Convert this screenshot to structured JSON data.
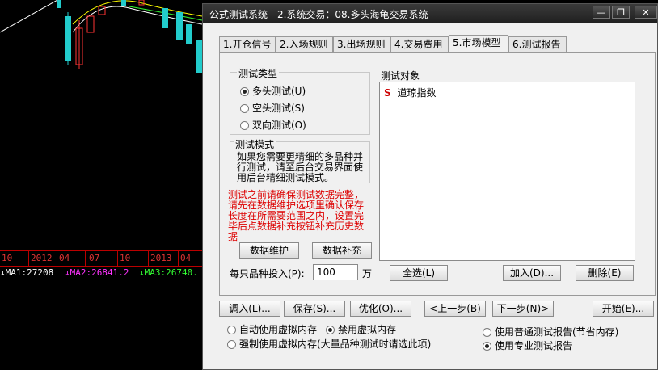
{
  "chart": {
    "axis_labels": [
      "10",
      "2012",
      "04",
      "07",
      "10",
      "2013",
      "04"
    ],
    "ma": [
      {
        "label": "↓MA1:27208",
        "color": "#ffffff"
      },
      {
        "label": "↓MA2:26841.2",
        "color": "#ff33ff"
      },
      {
        "label": "↓MA3:26740.",
        "color": "#33ff33"
      }
    ]
  },
  "window": {
    "title": "公式测试系统 - 2.系统交易：08.多头海龟交易系统",
    "controls": {
      "minimize": "—",
      "restore": "❐",
      "close": "✕"
    }
  },
  "tabs": [
    {
      "label": "1.开仓信号",
      "active": false
    },
    {
      "label": "2.入场规则",
      "active": false
    },
    {
      "label": "3.出场规则",
      "active": false
    },
    {
      "label": "4.交易费用",
      "active": false
    },
    {
      "label": "5.市场模型",
      "active": true
    },
    {
      "label": "6.测试报告",
      "active": false
    }
  ],
  "test_type": {
    "title": "测试类型",
    "options": [
      {
        "label": "多头测试(U)",
        "checked": true
      },
      {
        "label": "空头测试(S)",
        "checked": false
      },
      {
        "label": "双向测试(O)",
        "checked": false
      }
    ]
  },
  "test_mode": {
    "title": "测试模式",
    "text": "如果您需要更精细的多品种并行测试，请至后台交易界面使用后台精细测试模式。"
  },
  "warning": {
    "text": "测试之前请确保测试数据完整，请先在数据维护选项里确认保存长度在所需要范围之内，设置完毕后点数据补充按钮补充历史数据",
    "color": "#dd0000"
  },
  "buttons": {
    "data_maintain": "数据维护",
    "data_supplement": "数据补充",
    "select_all": "全选(L)",
    "add": "加入(D)...",
    "delete": "删除(E)",
    "import": "调入(L)...",
    "save": "保存(S)...",
    "optimize": "优化(O)...",
    "prev": "<上一步(B)",
    "next": "下一步(N)>",
    "start": "开始(E)..."
  },
  "invest": {
    "label": "每只品种投入(P):",
    "value": "100",
    "unit": "万"
  },
  "test_object": {
    "title": "测试对象",
    "items": [
      {
        "marker": "S",
        "name": "道琼指数",
        "marker_color": "#cc0000"
      }
    ]
  },
  "bottom_options": [
    {
      "label": "自动使用虚拟内存",
      "checked": false
    },
    {
      "label": "禁用虚拟内存",
      "checked": true
    },
    {
      "label": "强制使用虚拟内存(大量品种测试时请选此项)",
      "checked": false
    },
    {
      "label": "使用普通测试报告(节省内存)",
      "checked": false
    },
    {
      "label": "使用专业测试报告",
      "checked": true
    }
  ]
}
